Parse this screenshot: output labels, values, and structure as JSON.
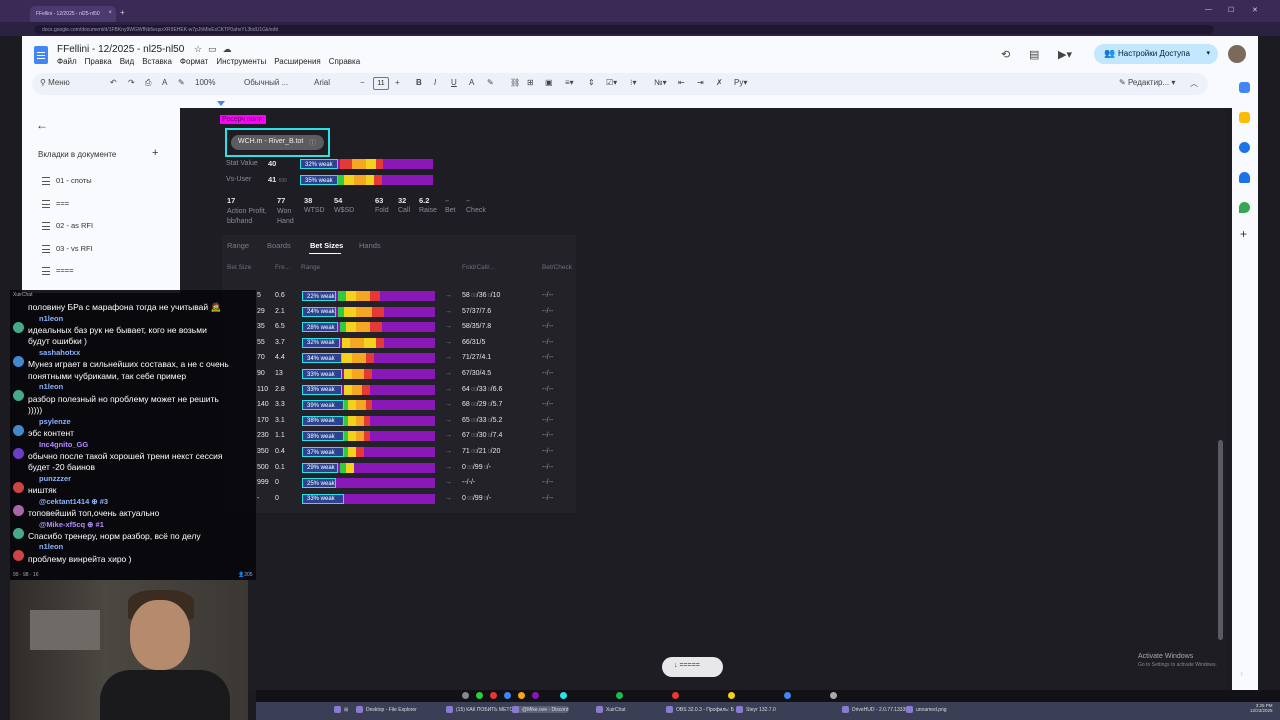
{
  "browser": {
    "tab_title": "FFellini - 12/2025 - nl25-nl50",
    "url": "docs.google.com/document/d/1FBKny9WGWfNb5eqsxXR9EHEK-w7pJhMleExCKTP0ahvYL3bdU1Gk/edit"
  },
  "docs": {
    "title": "FFellini - 12/2025 - nl25-nl50",
    "menu": [
      "Файл",
      "Правка",
      "Вид",
      "Вставка",
      "Формат",
      "Инструменты",
      "Расширения",
      "Справка"
    ],
    "share_label": "Настройки Доступа",
    "toolbar": {
      "search": "Меню",
      "zoom": "100%",
      "style": "Обычный ...",
      "font": "Arial",
      "size": "11",
      "editing": "Редактир..."
    }
  },
  "sidebar": {
    "tabs_heading": "Вкладки в документе",
    "items": [
      "01 - споты",
      "===",
      "02 - as RFI",
      "03 - vs RFI",
      "===="
    ]
  },
  "page": {
    "highlight": "Ресерч поля:",
    "player": "WCH.m - River_B.tot",
    "stat_value": {
      "label": "Stat Value",
      "value": "40",
      "bar": "32% weak"
    },
    "vs_user": {
      "label": "Vs-User",
      "value": "41",
      "sub": "690",
      "bar": "35% weak"
    },
    "summary": [
      {
        "value": "17",
        "label": "Action Profit, bb/hand"
      },
      {
        "value": "77",
        "label": "Won Hand"
      },
      {
        "value": "38",
        "label": "WTSD"
      },
      {
        "value": "54",
        "label": "W$SD"
      },
      {
        "value": "63",
        "label": "Fold"
      },
      {
        "value": "32",
        "label": "Call"
      },
      {
        "value": "6.2",
        "label": "Raise"
      },
      {
        "value": "–",
        "label": "Bet"
      },
      {
        "value": "–",
        "label": "Check"
      }
    ],
    "panel_tabs": [
      "Range",
      "Boards",
      "Bet Sizes",
      "Hands"
    ],
    "columns": [
      "Bet Size",
      "Fre...",
      "Range",
      "Fold/Call/...",
      "Bet/Check"
    ],
    "rows": [
      {
        "size": "5",
        "freq": "0.6",
        "bar": "22% weak",
        "fcr": "58",
        "fcr_rest": "/36",
        "fcr_rest2": "/10",
        "bc": "--/--"
      },
      {
        "size": "29",
        "freq": "2.1",
        "bar": "24% weak",
        "fcr": "57/37/7.6",
        "fcr_rest": "",
        "fcr_rest2": "",
        "bc": "--/--"
      },
      {
        "size": "35",
        "freq": "6.5",
        "bar": "28% weak",
        "fcr": "58/35/7.8",
        "fcr_rest": "",
        "fcr_rest2": "",
        "bc": "--/--"
      },
      {
        "size": "55",
        "freq": "3.7",
        "bar": "32% weak",
        "fcr": "66/31/5",
        "fcr_rest": "",
        "fcr_rest2": "",
        "bc": "--/--"
      },
      {
        "size": "70",
        "freq": "4.4",
        "bar": "34% weak",
        "fcr": "71/27/4.1",
        "fcr_rest": "",
        "fcr_rest2": "",
        "bc": "--/--"
      },
      {
        "size": "90",
        "freq": "13",
        "bar": "33% weak",
        "fcr": "67/30/4.5",
        "fcr_rest": "",
        "fcr_rest2": "",
        "bc": "--/--"
      },
      {
        "size": "110",
        "freq": "2.8",
        "bar": "33% weak",
        "fcr": "64",
        "fcr_rest": "/33",
        "fcr_rest2": "/6.6",
        "bc": "--/--"
      },
      {
        "size": "140",
        "freq": "3.3",
        "bar": "39% weak",
        "fcr": "68",
        "fcr_rest": "/29",
        "fcr_rest2": "/5.7",
        "bc": "--/--"
      },
      {
        "size": "170",
        "freq": "3.1",
        "bar": "38% weak",
        "fcr": "65",
        "fcr_rest": "/33",
        "fcr_rest2": "/5.2",
        "bc": "--/--"
      },
      {
        "size": "230",
        "freq": "1.1",
        "bar": "38% weak",
        "fcr": "67",
        "fcr_rest": "/30",
        "fcr_rest2": "/7.4",
        "bc": "--/--"
      },
      {
        "size": "350",
        "freq": "0.4",
        "bar": "37% weak",
        "fcr": "71",
        "fcr_rest": "/21",
        "fcr_rest2": "/20",
        "bc": "--/--"
      },
      {
        "size": "500",
        "freq": "0.1",
        "bar": "29% weak",
        "fcr": "0",
        "fcr_rest": "/99",
        "fcr_rest2": "/-",
        "bc": "--/--"
      },
      {
        "size": "999",
        "freq": "0",
        "bar": "25% weak",
        "fcr": "--/-/-",
        "fcr_rest": "",
        "fcr_rest2": "",
        "bc": "--/--"
      },
      {
        "size": "-",
        "freq": "0",
        "bar": "33% weak",
        "fcr": "0",
        "fcr_rest": "/99",
        "fcr_rest2": "/-",
        "bc": "--/--"
      }
    ],
    "float_button": "↓ ====="
  },
  "chat": {
    "header": "XuirChat",
    "lines": [
      {
        "type": "msg",
        "text": "половину БРа с марафона тогда не учитывай 🧟"
      },
      {
        "type": "user",
        "text": "n1leon",
        "color": "#8ab4ff"
      },
      {
        "type": "msg",
        "text": "идеальных баз рук не бывает, кого не возьми"
      },
      {
        "type": "msg",
        "text": "будут ошибки )"
      },
      {
        "type": "user",
        "text": "sashahotxx",
        "color": "#8ab4ff"
      },
      {
        "type": "msg",
        "text": "Мунез играет в сильнейших составах, а не с очень"
      },
      {
        "type": "msg",
        "text": "понятными чубриками, так себе пример"
      },
      {
        "type": "user",
        "text": "n1leon",
        "color": "#8ab4ff"
      },
      {
        "type": "msg",
        "text": "разбор полезный но проблему может не решить"
      },
      {
        "type": "msg",
        "text": ")))))"
      },
      {
        "type": "user",
        "text": "psylenze",
        "color": "#8ab4ff"
      },
      {
        "type": "msg",
        "text": "эбс контент"
      },
      {
        "type": "user",
        "text": "Inc4gnito_GG",
        "color": "#b58cff"
      },
      {
        "type": "msg",
        "text": "обычно после такой хорошей трени некст сессия"
      },
      {
        "type": "msg",
        "text": "будет -20 баинов"
      },
      {
        "type": "user",
        "text": "punzzzer",
        "color": "#8ab4ff"
      },
      {
        "type": "msg",
        "text": "ништяк"
      },
      {
        "type": "user",
        "text": "@cektant1414 ⊕ #3",
        "color": "#8ab4ff"
      },
      {
        "type": "msg",
        "text": "топовейший топ,очень актуально"
      },
      {
        "type": "user",
        "text": "@Mike-xf5cq ⊕ #1",
        "color": "#b58cff"
      },
      {
        "type": "msg",
        "text": "Спасибо тренеру, норм разбор, всё по делу"
      },
      {
        "type": "user",
        "text": "n1leon",
        "color": "#8ab4ff"
      },
      {
        "type": "msg",
        "text": "проблему винрейта хиро )"
      }
    ],
    "footer_left": "99 · 98 · 16",
    "footer_right": "205"
  },
  "system": {
    "activate_title": "Activate Windows",
    "activate_sub": "Go to Settings to activate Windows.",
    "time": "3:25 PM",
    "date": "12/23/2025",
    "taskbar": [
      "Desktop - File Explorer",
      "(15) КАК ПОБИТЬ МЕТС",
      "@Mike.ove - Discord",
      "XuirChat",
      "OBS 32.0.3 - Профиль: Б",
      "Steyr 132.7.0",
      "DriveHUD - 2.0.77.13335",
      "unnamed.png"
    ]
  }
}
